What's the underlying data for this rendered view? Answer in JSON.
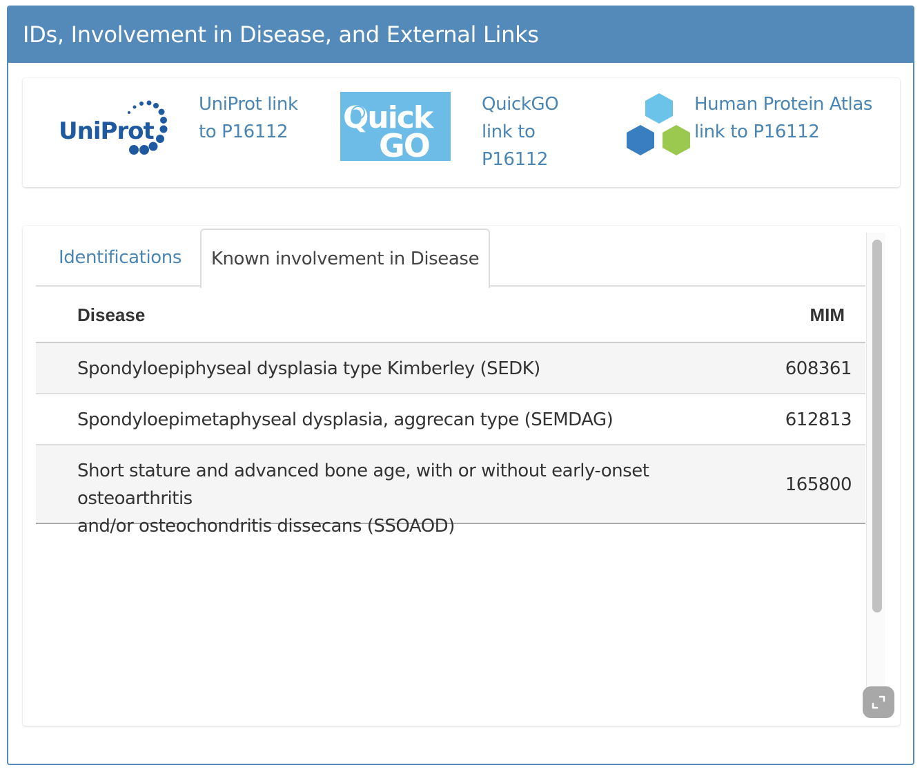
{
  "panel": {
    "title": "IDs, Involvement in Disease, and External Links"
  },
  "links": [
    {
      "logo_text": "UniProt",
      "icon": "uniprot-logo",
      "label_lines": [
        "UniProt link",
        "to P16112"
      ]
    },
    {
      "logo_text_top": "Quick",
      "logo_text_bottom": "GO",
      "icon": "quickgo-logo",
      "label_lines": [
        "QuickGO",
        "link to",
        "P16112"
      ]
    },
    {
      "icon": "human-protein-atlas-logo",
      "label_lines": [
        "Human Protein Atlas",
        "link to P16112"
      ]
    }
  ],
  "tabs": [
    {
      "label": "Identifications",
      "active": false
    },
    {
      "label": "Known involvement in Disease",
      "active": true
    }
  ],
  "table": {
    "headers": {
      "disease": "Disease",
      "mim": "MIM"
    },
    "rows": [
      {
        "disease_lines": [
          "Spondyloepiphyseal dysplasia type Kimberley (SEDK)"
        ],
        "mim": "608361"
      },
      {
        "disease_lines": [
          "Spondyloepimetaphyseal dysplasia, aggrecan type (SEMDAG)"
        ],
        "mim": "612813"
      },
      {
        "disease_lines": [
          "Short stature and advanced bone age, with or without early-onset osteoarthritis",
          "and/or osteochondritis dissecans (SSOAOD)"
        ],
        "mim": "165800"
      }
    ]
  },
  "colors": {
    "header_bg": "#548ab9",
    "link": "#4a85b4",
    "uniprot_blue": "#1f5aa0",
    "quickgo_bg": "#6cbce7",
    "hpa_light_blue": "#6cc3ea",
    "hpa_dark_blue": "#3a7ec2",
    "hpa_green": "#9bc84e"
  },
  "controls": {
    "expand_icon": "expand-icon",
    "scrollbar": "vertical-scrollbar"
  }
}
